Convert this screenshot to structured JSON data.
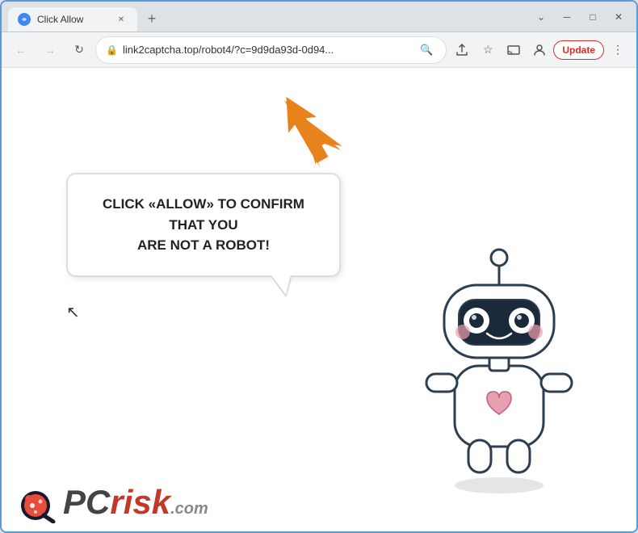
{
  "window": {
    "title": "Click Allow",
    "url": "link2captcha.top/robot4/?c=9d9da93d-0d94...",
    "update_btn": "Update"
  },
  "nav": {
    "back_title": "Back",
    "forward_title": "Forward",
    "refresh_title": "Refresh"
  },
  "page": {
    "bubble_line1": "CLICK «ALLOW» TO CONFIRM THAT YOU",
    "bubble_line2": "ARE NOT A ROBOT!"
  },
  "logo": {
    "pc": "PC",
    "risk": "risk",
    "domain": ".com"
  },
  "icons": {
    "chevron_down": "⌄",
    "minimize": "─",
    "restore": "□",
    "close": "✕",
    "back": "←",
    "forward": "→",
    "refresh": "↻",
    "lock": "🔒",
    "search": "🔍",
    "share": "⬆",
    "star": "☆",
    "cast": "▭",
    "profile": "👤",
    "more": "⋮",
    "new_tab": "+"
  }
}
